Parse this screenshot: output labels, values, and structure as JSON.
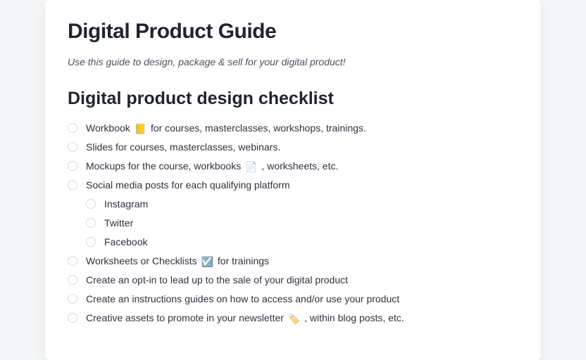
{
  "title": "Digital Product Guide",
  "subtitle": "Use this guide to design, package & sell for your digital product!",
  "section_heading": "Digital product design checklist",
  "items": [
    {
      "pre": "Workbook ",
      "emoji": "📒",
      "post": " for courses, masterclasses, workshops, trainings."
    },
    {
      "pre": "Slides for courses, masterclasses, webinars.",
      "emoji": "",
      "post": ""
    },
    {
      "pre": "Mockups for the course, workbooks ",
      "emoji": "📄",
      "post": " , worksheets, etc."
    },
    {
      "pre": "Social media posts for each qualifying platform",
      "emoji": "",
      "post": "",
      "children": [
        {
          "pre": "Instagram"
        },
        {
          "pre": "Twitter"
        },
        {
          "pre": "Facebook"
        }
      ]
    },
    {
      "pre": "Worksheets or Checklists ",
      "emoji": "☑️",
      "post": " for trainings"
    },
    {
      "pre": "Create an opt-in to lead up to the sale of your digital product",
      "emoji": "",
      "post": ""
    },
    {
      "pre": "Create an instructions guides on how to access and/or use your product",
      "emoji": "",
      "post": ""
    },
    {
      "pre": "Creative assets to promote in your newsletter ",
      "emoji": "🏷️",
      "post": " , within blog posts, etc."
    }
  ]
}
